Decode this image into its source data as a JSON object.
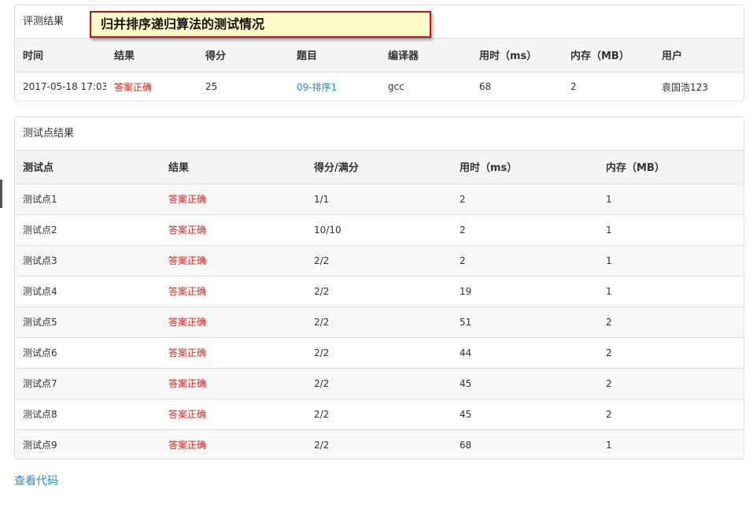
{
  "banner": {
    "text": "归并排序递归算法的测试情况"
  },
  "judge": {
    "title": "评测结果",
    "headers": [
      "时间",
      "结果",
      "得分",
      "题目",
      "编译器",
      "用时（ms）",
      "内存（MB）",
      "用户"
    ],
    "row": {
      "time": "2017-05-18 17:03",
      "result": "答案正确",
      "score": "25",
      "problem": "09-排序1",
      "compiler": "gcc",
      "time_ms": "68",
      "memory_mb": "2",
      "user": "袁国浩123"
    }
  },
  "testcases": {
    "title": "测试点结果",
    "headers": [
      "测试点",
      "结果",
      "得分/满分",
      "用时（ms）",
      "内存（MB）"
    ],
    "rows": [
      {
        "name": "测试点1",
        "result": "答案正确",
        "score": "1/1",
        "time_ms": "2",
        "memory_mb": "1"
      },
      {
        "name": "测试点2",
        "result": "答案正确",
        "score": "10/10",
        "time_ms": "2",
        "memory_mb": "1"
      },
      {
        "name": "测试点3",
        "result": "答案正确",
        "score": "2/2",
        "time_ms": "2",
        "memory_mb": "1"
      },
      {
        "name": "测试点4",
        "result": "答案正确",
        "score": "2/2",
        "time_ms": "19",
        "memory_mb": "1"
      },
      {
        "name": "测试点5",
        "result": "答案正确",
        "score": "2/2",
        "time_ms": "51",
        "memory_mb": "2"
      },
      {
        "name": "测试点6",
        "result": "答案正确",
        "score": "2/2",
        "time_ms": "44",
        "memory_mb": "2"
      },
      {
        "name": "测试点7",
        "result": "答案正确",
        "score": "2/2",
        "time_ms": "45",
        "memory_mb": "2"
      },
      {
        "name": "测试点8",
        "result": "答案正确",
        "score": "2/2",
        "time_ms": "45",
        "memory_mb": "2"
      },
      {
        "name": "测试点9",
        "result": "答案正确",
        "score": "2/2",
        "time_ms": "68",
        "memory_mb": "1"
      }
    ]
  },
  "view_code": {
    "label": "查看代码"
  },
  "colors": {
    "success": "#d9241c",
    "link": "#2a8bd1",
    "banner_bg": "#fffbc6",
    "banner_border": "#c0141c"
  }
}
